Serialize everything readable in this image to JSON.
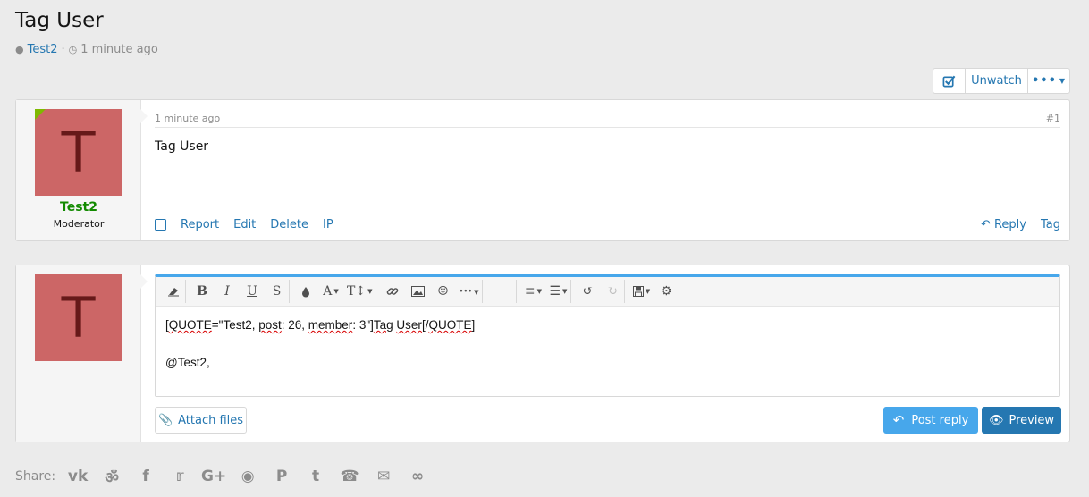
{
  "thread": {
    "title": "Tag User",
    "author": "Test2",
    "separator": "·",
    "time": "1 minute ago"
  },
  "thread_actions": {
    "unwatch_label": "Unwatch",
    "more_label": "•••"
  },
  "post": {
    "username": "Test2",
    "user_title": "Moderator",
    "avatar_letter": "T",
    "time": "1 minute ago",
    "number": "#1",
    "body": "Tag User",
    "actions": [
      "Report",
      "Edit",
      "Delete",
      "IP"
    ],
    "reply_label": "Reply",
    "tag_label": "Tag"
  },
  "reply_box": {
    "avatar_letter": "T",
    "editor_line1_prefix": "[",
    "editor_line1_quote": "QUOTE",
    "editor_line1_mid1": "=\"Test2, ",
    "editor_line1_post": "post",
    "editor_line1_mid2": ": 26, ",
    "editor_line1_member": "member",
    "editor_line1_mid3": ": 3\"]",
    "editor_line1_tag": "Tag",
    "editor_line1_mid4": " ",
    "editor_line1_user": "User",
    "editor_line1_mid5": "[/",
    "editor_line1_quote_end": "QUOTE",
    "editor_line1_suffix": "]",
    "editor_line2": "@Test2,",
    "attach_label": "Attach files",
    "post_reply_label": "Post reply",
    "preview_label": "Preview"
  },
  "share": {
    "label": "Share:",
    "icons": [
      "vk-icon",
      "odnoklassniki-icon",
      "facebook-icon",
      "twitter-icon",
      "google-plus-icon",
      "reddit-icon",
      "pinterest-icon",
      "tumblr-icon",
      "whatsapp-icon",
      "email-icon",
      "link-icon"
    ]
  },
  "colors": {
    "accent": "#2577b1",
    "accent_light": "#47a7eb",
    "username": "#128a00",
    "avatar_bg": "#cc6666"
  }
}
